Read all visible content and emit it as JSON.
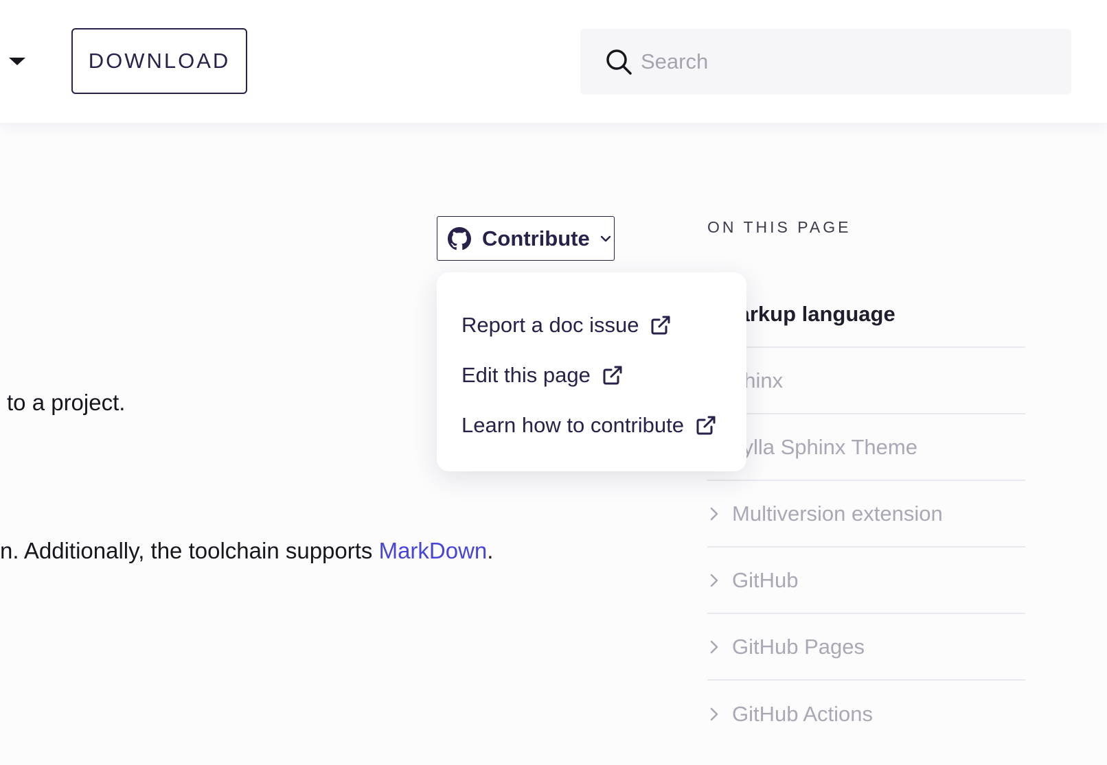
{
  "header": {
    "download_label": "DOWNLOAD",
    "search_placeholder": "Search"
  },
  "content": {
    "para1": "to a project.",
    "para2_prefix": "n. Additionally, the toolchain supports ",
    "para2_link": "MarkDown",
    "para2_suffix": "."
  },
  "contribute": {
    "label": "Contribute",
    "menu": [
      {
        "label": "Report a doc issue"
      },
      {
        "label": "Edit this page"
      },
      {
        "label": "Learn how to contribute"
      }
    ]
  },
  "toc": {
    "title": "ON THIS PAGE",
    "items": [
      {
        "label": "larkup language"
      },
      {
        "label": "phinx"
      },
      {
        "label": "cylla Sphinx Theme"
      },
      {
        "label": "Multiversion extension"
      },
      {
        "label": "GitHub"
      },
      {
        "label": "GitHub Pages"
      },
      {
        "label": "GitHub Actions"
      }
    ]
  },
  "colors": {
    "accent": "#262249",
    "link": "#4745d8",
    "muted": "#a9a9b6"
  }
}
